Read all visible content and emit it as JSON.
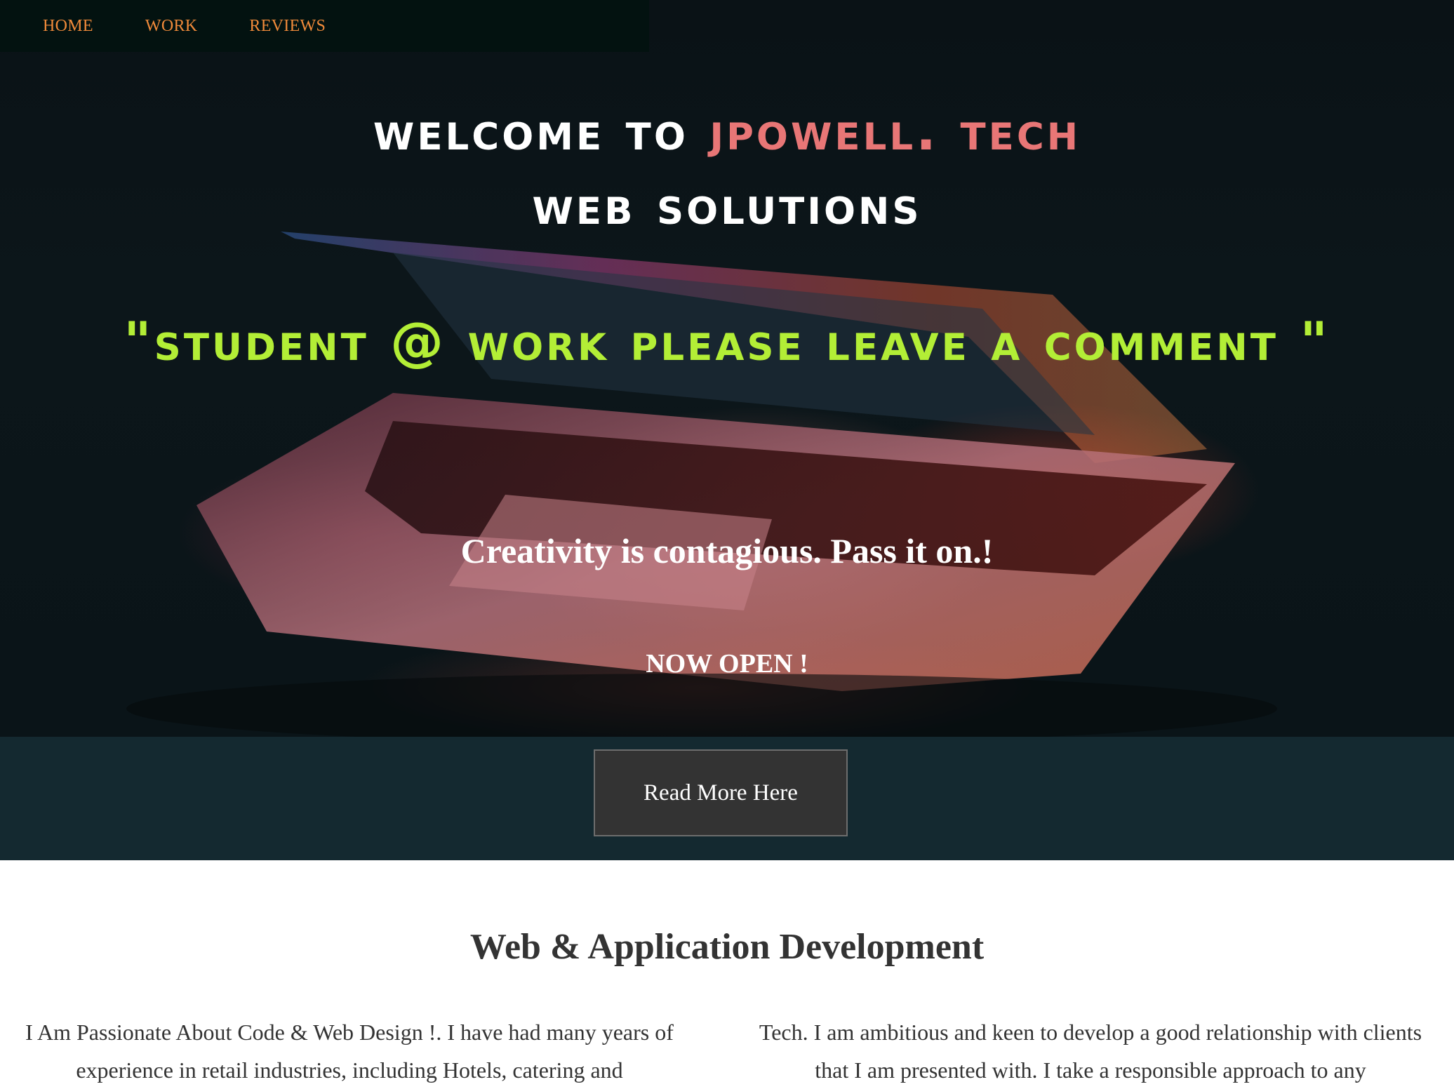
{
  "nav": {
    "items": [
      {
        "label": "HOME"
      },
      {
        "label": "WORK"
      },
      {
        "label": "REVIEWS"
      }
    ]
  },
  "hero": {
    "title_prefix": "Welcome To ",
    "title_accent": "JPowell. Tech",
    "subtitle": "Web Solutions",
    "quote": "\"Student @ Work Please Leave a Comment \"",
    "motto": "Creativity is contagious. Pass it on.!",
    "status": "NOW OPEN !"
  },
  "band": {
    "button_label": "Read More Here"
  },
  "section": {
    "title": "Web & Application Development",
    "col_left": "I Am Passionate About Code & Web Design !. I have had many years of experience in retail industries, including Hotels, catering and",
    "col_right": "Tech. I am ambitious and keen to develop a good relationship with clients that I am presented with. I take a responsible approach to any"
  },
  "colors": {
    "nav_link": "#f08a3a",
    "title_accent": "#e87676",
    "quote": "#b3ee36",
    "band": "#142930",
    "button_bg": "#333333"
  }
}
